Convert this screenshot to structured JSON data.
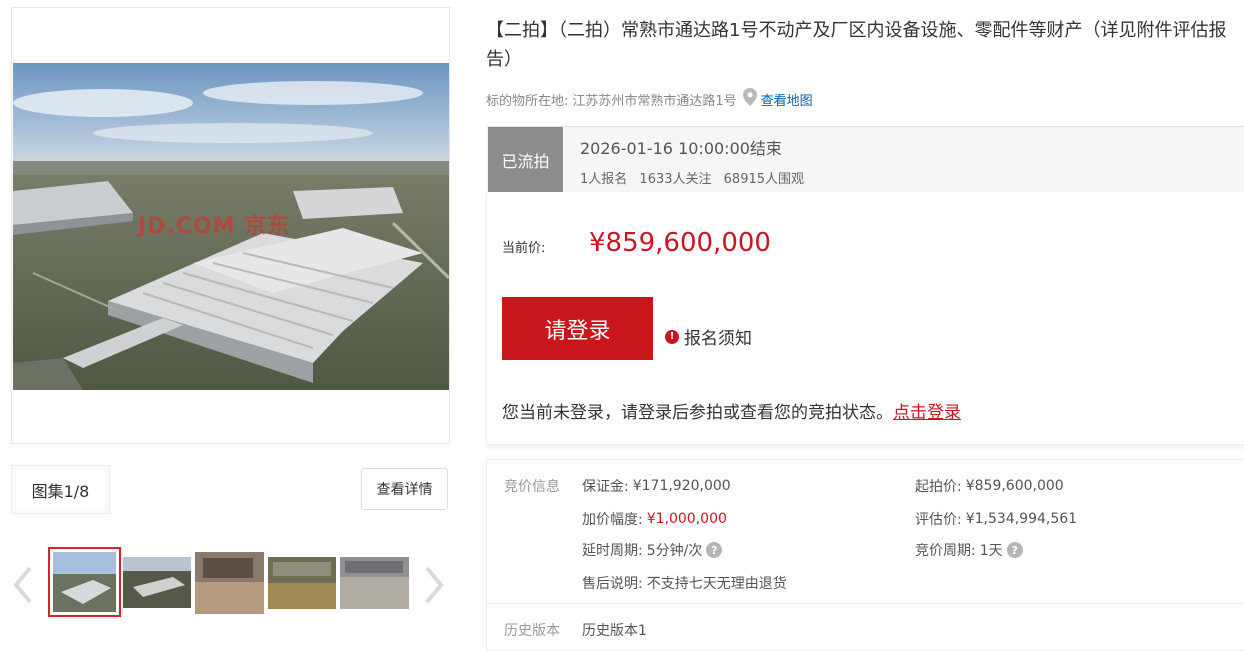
{
  "gallery": {
    "watermark": "JD.COM 京东",
    "album_count": "图集1/8",
    "view_detail_label": "查看详情"
  },
  "item": {
    "title": "【二拍】（二拍）常熟市通达路1号不动产及厂区内设备设施、零配件等财产（详见附件评估报告）",
    "location_label": "标的物所在地:",
    "location_value": "江苏苏州市常熟市通达路1号",
    "map_link": "查看地图"
  },
  "status": {
    "tag": "已流拍",
    "end_time": "2026-01-16 10:00:00结束",
    "signups": "1人报名",
    "followers": "1633人关注",
    "viewers": "68915人围观"
  },
  "price": {
    "label": "当前价:",
    "value": "¥859,600,000",
    "login_button": "请登录",
    "notice_label": "报名须知",
    "login_tip": "您当前未登录，请登录后参拍或查看您的竞拍状态。",
    "login_link": "点击登录"
  },
  "details": {
    "section_label": "竞价信息",
    "deposit_label": "保证金:",
    "deposit_value": "¥171,920,000",
    "start_price_label": "起拍价:",
    "start_price_value": "¥859,600,000",
    "increment_label": "加价幅度:",
    "increment_value": "¥1,000,000",
    "appraisal_label": "评估价:",
    "appraisal_value": "¥1,534,994,561",
    "delay_label": "延时周期:",
    "delay_value": "5分钟/次",
    "cycle_label": "竞价周期:",
    "cycle_value": "1天",
    "aftersale_label": "售后说明:",
    "aftersale_value": "不支持七天无理由退货",
    "history_section_label": "历史版本",
    "history_value": "历史版本1"
  },
  "colors": {
    "accent_red": "#c8161d",
    "price_red": "#c81623",
    "status_gray": "#8c8c8c",
    "link_blue": "#005ea7"
  }
}
